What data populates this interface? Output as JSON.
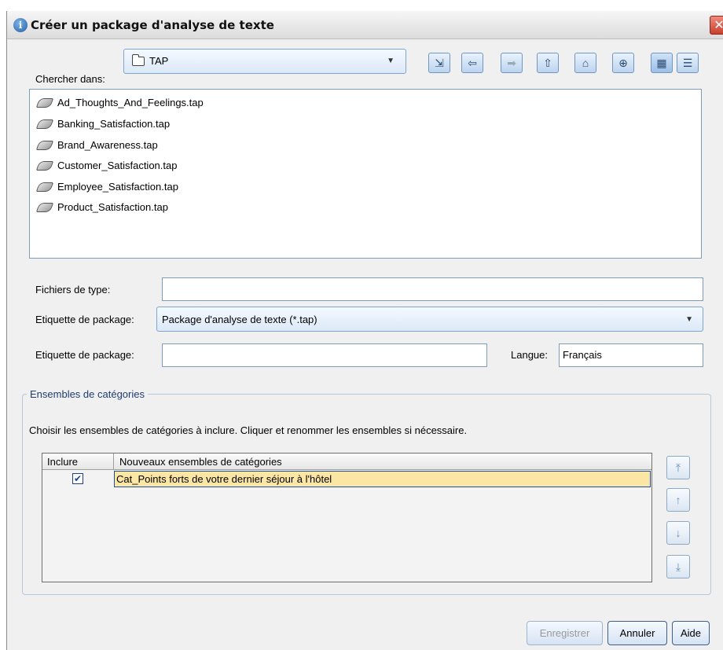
{
  "window": {
    "title": "Créer un package d'analyse de texte",
    "close_glyph": "✕"
  },
  "look_in": {
    "label": "Chercher dans:",
    "value": "TAP"
  },
  "toolbar": {
    "buttons": [
      {
        "name": "find-folder-icon",
        "glyph": "⇲"
      },
      {
        "name": "back-icon",
        "glyph": "⇦"
      },
      {
        "name": "forward-icon",
        "glyph": "➡"
      },
      {
        "name": "up-folder-icon",
        "glyph": "⇧"
      },
      {
        "name": "home-icon",
        "glyph": "⌂"
      },
      {
        "name": "new-folder-icon",
        "glyph": "⊕"
      },
      {
        "name": "list-view-icon",
        "glyph": "▦"
      },
      {
        "name": "details-view-icon",
        "glyph": "☰"
      }
    ]
  },
  "files": [
    "Ad_Thoughts_And_Feelings.tap",
    "Banking_Satisfaction.tap",
    "Brand_Awareness.tap",
    "Customer_Satisfaction.tap",
    "Employee_Satisfaction.tap",
    "Product_Satisfaction.tap"
  ],
  "file_type": {
    "label": "Fichiers de type:",
    "value": ""
  },
  "package_type": {
    "label": "Etiquette de package:",
    "value": "Package d'analyse de texte (*.tap)"
  },
  "package_label": {
    "label": "Etiquette de package:",
    "value": ""
  },
  "language": {
    "label": "Langue:",
    "value": "Français"
  },
  "category_sets": {
    "legend": "Ensembles de catégories",
    "description": "Choisir les ensembles de catégories à inclure. Cliquer et renommer les ensembles si nécessaire.",
    "columns": {
      "include": "Inclure",
      "name": "Nouveaux ensembles de catégories"
    },
    "rows": [
      {
        "checked_glyph": "✔",
        "name": "Cat_Points forts de votre dernier séjour à l'hôtel"
      }
    ],
    "side_buttons": {
      "top": "⤒",
      "up": "↑",
      "down": "↓",
      "bottom": "⤓"
    }
  },
  "buttons": {
    "save": "Enregistrer",
    "cancel": "Annuler",
    "help": "Aide"
  }
}
